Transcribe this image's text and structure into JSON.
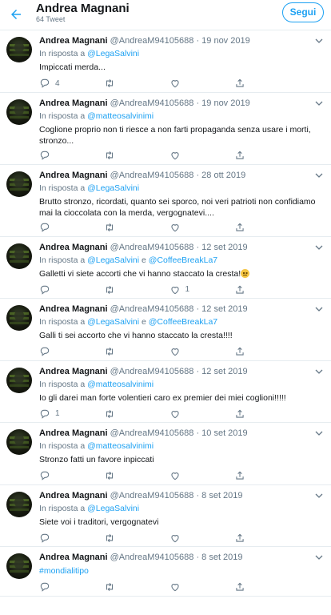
{
  "header": {
    "name": "Andrea Magnani",
    "tweet_count": "64 Tweet",
    "follow_label": "Segui"
  },
  "colors": {
    "accent": "#1da1f2",
    "muted": "#657786",
    "border": "#e6ecf0"
  },
  "tweets": [
    {
      "name": "Andrea Magnani",
      "meta": "@AndreaM94105688 · 19 nov 2019",
      "reply_prefix": "In risposta a",
      "reply_to": "@LegaSalvini",
      "reply_and": "",
      "reply_to2": "",
      "text": "Impiccati merda...",
      "replies": "4",
      "retweets": "",
      "likes": ""
    },
    {
      "name": "Andrea Magnani",
      "meta": "@AndreaM94105688 · 19 nov 2019",
      "reply_prefix": "In risposta a",
      "reply_to": "@matteosalvinimi",
      "reply_and": "",
      "reply_to2": "",
      "text": "Coglione proprio non ti riesce a non farti propaganda senza usare i morti, stronzo...",
      "replies": "",
      "retweets": "",
      "likes": ""
    },
    {
      "name": "Andrea Magnani",
      "meta": "@AndreaM94105688 · 28 ott 2019",
      "reply_prefix": "In risposta a",
      "reply_to": "@LegaSalvini",
      "reply_and": "",
      "reply_to2": "",
      "text": "Brutto stronzo, ricordati, quanto sei sporco, noi veri patrioti non confidiamo mai la cioccolata con la merda, vergognatevi....",
      "replies": "",
      "retweets": "",
      "likes": ""
    },
    {
      "name": "Andrea Magnani",
      "meta": "@AndreaM94105688 · 12 set 2019",
      "reply_prefix": "In risposta a",
      "reply_to": "@LegaSalvini",
      "reply_and": "e",
      "reply_to2": "@CoffeeBreakLa7",
      "text": "Galletti vi siete accorti che vi hanno staccato la cresta!",
      "replies": "",
      "retweets": "",
      "likes": "1"
    },
    {
      "name": "Andrea Magnani",
      "meta": "@AndreaM94105688 · 12 set 2019",
      "reply_prefix": "In risposta a",
      "reply_to": "@LegaSalvini",
      "reply_and": "e",
      "reply_to2": "@CoffeeBreakLa7",
      "text": "Galli ti sei accorto che vi hanno staccato la cresta!!!!",
      "replies": "",
      "retweets": "",
      "likes": ""
    },
    {
      "name": "Andrea Magnani",
      "meta": "@AndreaM94105688 · 12 set 2019",
      "reply_prefix": "In risposta a",
      "reply_to": "@matteosalvinimi",
      "reply_and": "",
      "reply_to2": "",
      "text": "Io gli darei man forte volentieri caro ex premier dei miei coglioni!!!!!",
      "replies": "1",
      "retweets": "",
      "likes": ""
    },
    {
      "name": "Andrea Magnani",
      "meta": "@AndreaM94105688 · 10 set 2019",
      "reply_prefix": "In risposta a",
      "reply_to": "@matteosalvinimi",
      "reply_and": "",
      "reply_to2": "",
      "text": "Stronzo fatti un favore inpiccati",
      "replies": "",
      "retweets": "",
      "likes": ""
    },
    {
      "name": "Andrea Magnani",
      "meta": "@AndreaM94105688 · 8 set 2019",
      "reply_prefix": "In risposta a",
      "reply_to": "@LegaSalvini",
      "reply_and": "",
      "reply_to2": "",
      "text": "Siete voi i traditori, vergognatevi",
      "replies": "",
      "retweets": "",
      "likes": ""
    },
    {
      "name": "Andrea Magnani",
      "meta": "@AndreaM94105688 · 8 set 2019",
      "reply_prefix": "",
      "reply_to": "",
      "reply_and": "",
      "reply_to2": "",
      "text": "",
      "hashtag": "#mondialitipo",
      "replies": "",
      "retweets": "",
      "likes": ""
    }
  ]
}
